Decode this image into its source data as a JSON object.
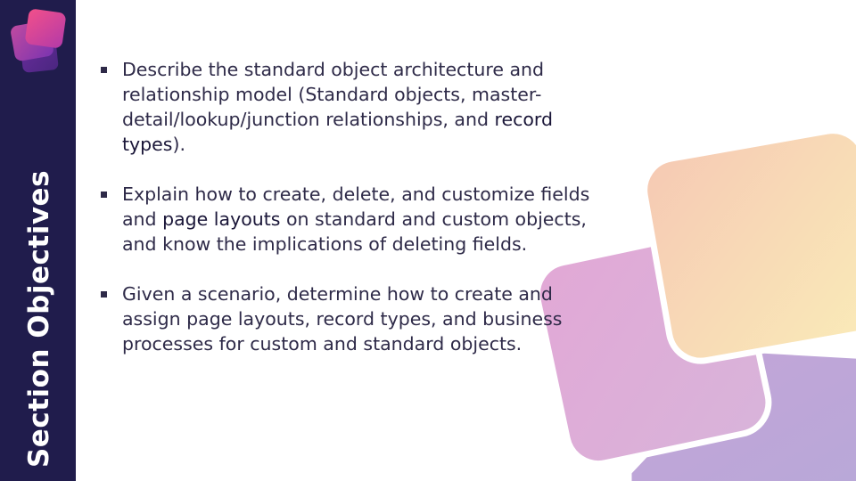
{
  "sidebar": {
    "title": "Section Objectives"
  },
  "colors": {
    "sidebar_bg": "#201c4c",
    "text": "#2e2a48",
    "logo_front": "#e0408a",
    "logo_back": "#6a2c9c",
    "shape_top": "#f8dca8",
    "shape_middle": "#e0b8dc",
    "shape_bottom": "#b8a8d8"
  },
  "objectives": [
    {
      "before": "Describe the standard object architecture and relationship model (Standard objects, master-detail/lookup/junction relationships, and ",
      "highlight": "record types",
      "after": ")."
    },
    {
      "before": "Explain how to create, delete, and customize fields and ",
      "highlight": "page layouts",
      "after": " on standard and custom objects, and know the implications of deleting fields."
    },
    {
      "before": "Given a scenario, determine how to create and assign page layouts, record types, and business processes for custom and standard objects.",
      "highlight": "",
      "after": ""
    }
  ]
}
